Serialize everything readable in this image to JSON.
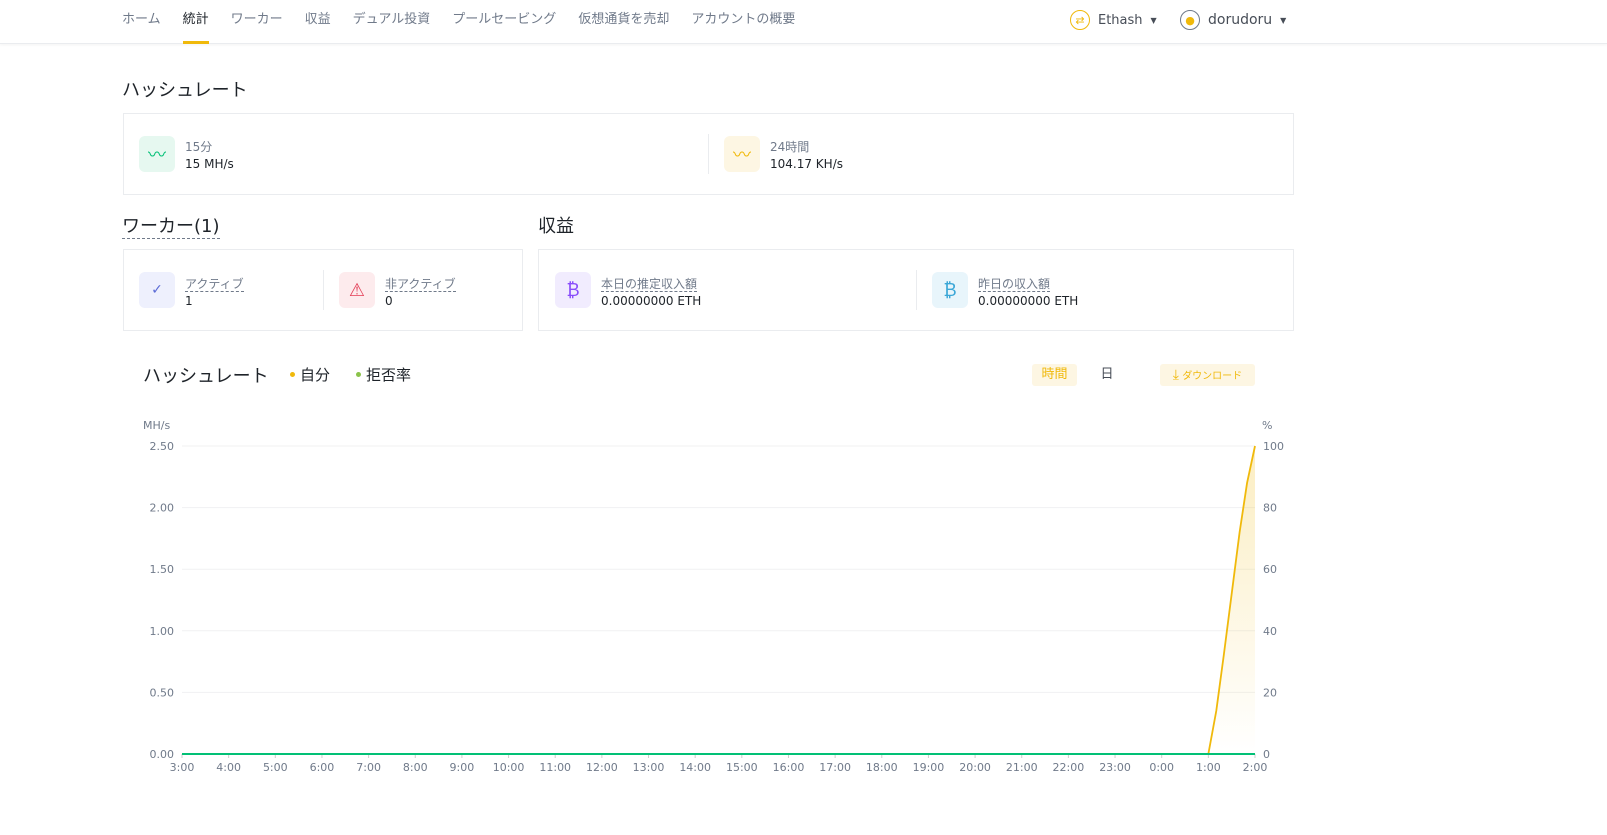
{
  "nav": {
    "items": [
      "ホーム",
      "統計",
      "ワーカー",
      "収益",
      "デュアル投資",
      "プールセービング",
      "仮想通貨を売却",
      "アカウントの概要"
    ],
    "active": 1
  },
  "header": {
    "algo": "Ethash",
    "user": "dorudoru"
  },
  "hashrate": {
    "title": "ハッシュレート",
    "m15_label": "15分",
    "m15_value": "15 MH/s",
    "h24_label": "24時間",
    "h24_value": "104.17 KH/s"
  },
  "workers": {
    "title": "ワーカー(1)",
    "active_label": "アクティブ",
    "active_value": "1",
    "inactive_label": "非アクティブ",
    "inactive_value": "0"
  },
  "earnings": {
    "title": "収益",
    "today_label": "本日の推定収入額",
    "today_value": "0.00000000 ETH",
    "yesterday_label": "昨日の収入額",
    "yesterday_value": "0.00000000 ETH"
  },
  "chart_controls": {
    "hour": "時間",
    "day": "日",
    "download": "ダウンロード"
  },
  "colors": {
    "accent": "#f0b90b",
    "green": "#02c076"
  },
  "chart_data": {
    "type": "line",
    "title": "ハッシュレート",
    "legend": [
      "自分",
      "拒否率"
    ],
    "ylabel": "MH/s",
    "y2label": "%",
    "ylim": [
      0,
      2.5
    ],
    "y2lim": [
      0,
      100
    ],
    "yticks": [
      "0.00",
      "0.50",
      "1.00",
      "1.50",
      "2.00",
      "2.50"
    ],
    "y2ticks": [
      "0",
      "20",
      "40",
      "60",
      "80",
      "100"
    ],
    "categories": [
      "3:00",
      "4:00",
      "5:00",
      "6:00",
      "7:00",
      "8:00",
      "9:00",
      "10:00",
      "11:00",
      "12:00",
      "13:00",
      "14:00",
      "15:00",
      "16:00",
      "17:00",
      "18:00",
      "19:00",
      "20:00",
      "21:00",
      "22:00",
      "23:00",
      "0:00",
      "1:00",
      "2:00"
    ],
    "series": [
      {
        "name": "自分",
        "color": "#f0b90b",
        "x": [
          0,
          22,
          22.17,
          22.33,
          22.5,
          22.67,
          22.83,
          23
        ],
        "values": [
          0,
          0,
          0.35,
          0.8,
          1.3,
          1.8,
          2.2,
          2.5
        ]
      },
      {
        "name": "拒否率",
        "color": "#02c076",
        "x": [
          0,
          23
        ],
        "values": [
          0,
          0
        ]
      }
    ]
  }
}
